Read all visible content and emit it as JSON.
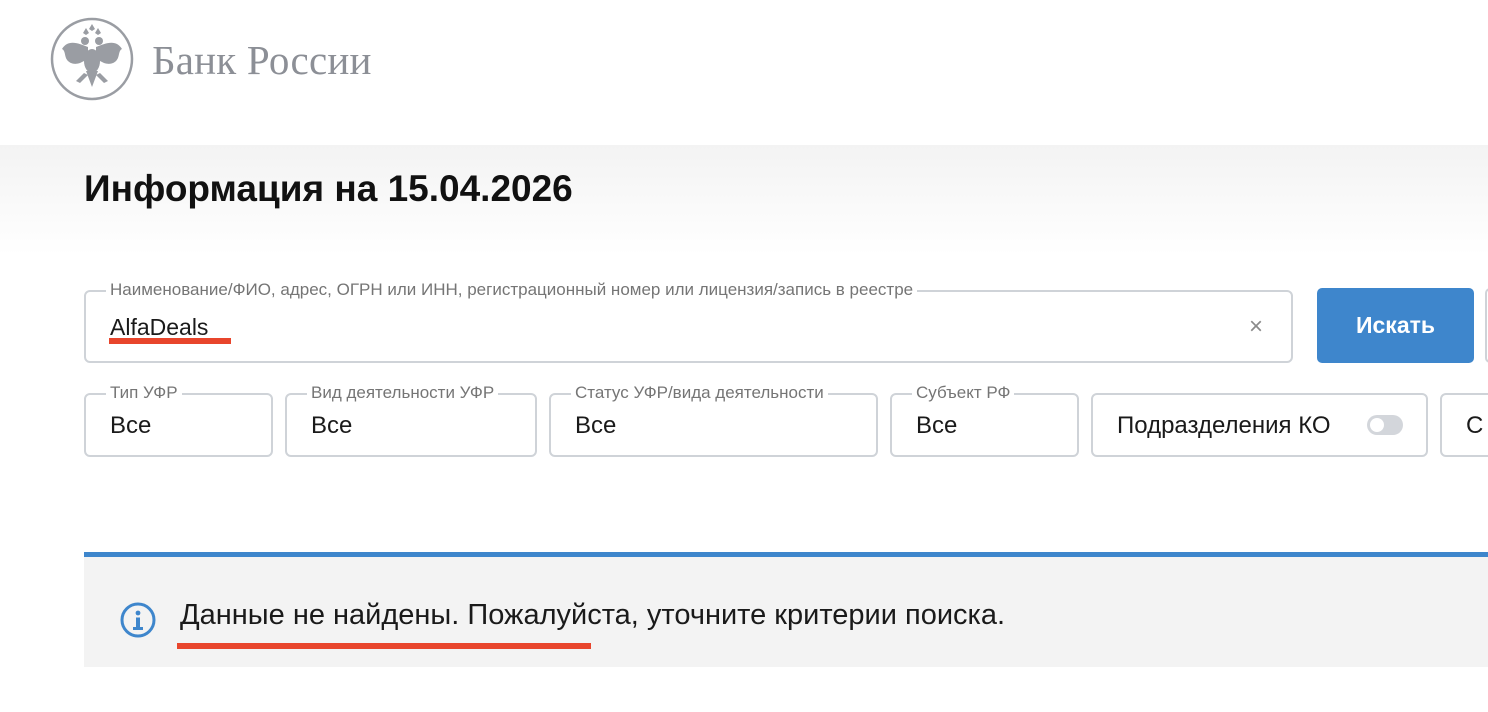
{
  "header": {
    "logo_text": "Банк России",
    "logo_icon": "double-headed-eagle-emblem"
  },
  "main": {
    "title": "Информация на 15.04.2026"
  },
  "search": {
    "label": "Наименование/ФИО, адрес, ОГРН или ИНН, регистрационный номер или лицензия/запись в реестре",
    "value": "AlfaDeals",
    "clear_icon": "×",
    "button_label": "Искать"
  },
  "filters": {
    "type": {
      "label": "Тип УФР",
      "value": "Все"
    },
    "activity": {
      "label": "Вид деятельности УФР",
      "value": "Все"
    },
    "status": {
      "label": "Статус УФР/вида деятельности",
      "value": "Все"
    },
    "region": {
      "label": "Субъект РФ",
      "value": "Все"
    },
    "ko_subdivisions": {
      "label": "Подразделения КО",
      "enabled": false
    },
    "cut_off": {
      "value": "С"
    }
  },
  "result": {
    "icon": "info-icon",
    "message": "Данные не найдены. Пожалуйста, уточните критерии поиска."
  },
  "colors": {
    "accent": "#3e86cc",
    "annotation": "#e8452c",
    "logo_gray": "#8c8f96"
  }
}
